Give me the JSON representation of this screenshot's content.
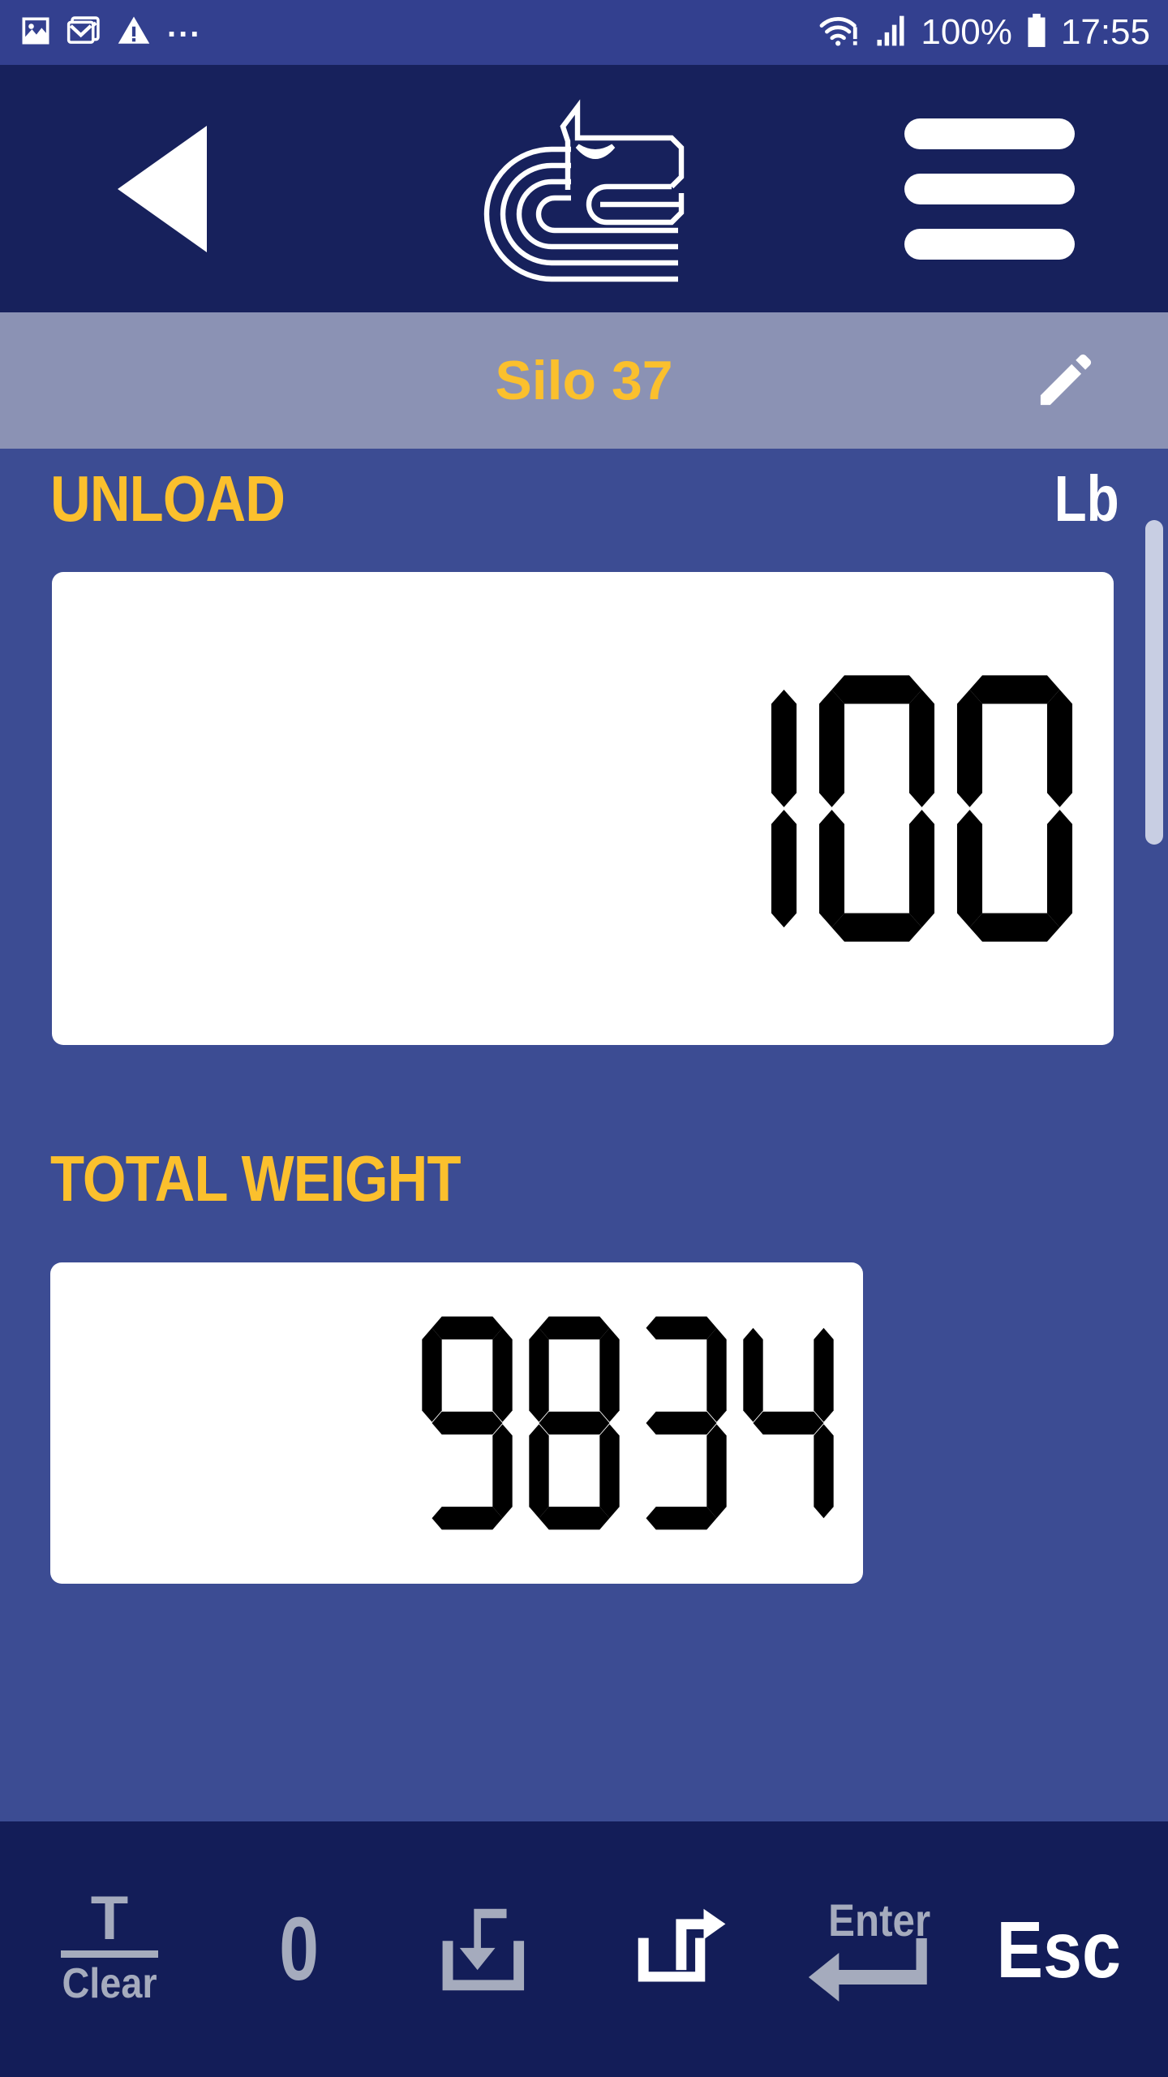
{
  "status_bar": {
    "left_icons": [
      "image-icon",
      "email-icon",
      "warning-icon"
    ],
    "overflow_dots": "...",
    "wifi_icon": "wifi-warning-icon",
    "signal_icon": "signal-bars-icon",
    "battery_percent": "100%",
    "battery_icon": "battery-full-icon",
    "time": "17:55"
  },
  "header": {
    "back_label": "back-arrow",
    "logo_label": "bull-head-logo",
    "menu_label": "menu"
  },
  "title_bar": {
    "title": "Silo 37",
    "edit_label": "edit"
  },
  "main": {
    "mode_label": "UNLOAD",
    "unit_label": "Lb",
    "primary_value": "100",
    "total_label": "TOTAL WEIGHT",
    "total_value": "9834"
  },
  "toolbar": {
    "tare_symbol": "T",
    "tare_label": "Clear",
    "zero_label": "0",
    "load_in_label": "load-in",
    "unload_out_label": "unload-out",
    "enter_label": "Enter",
    "esc_label": "Esc"
  },
  "colors": {
    "status_bar_bg": "#33408f",
    "header_bg": "#17215c",
    "title_bar_bg": "#8b92b4",
    "body_bg": "#3c4c93",
    "bottom_bar_bg": "#131d58",
    "accent_gold": "#fbc02d",
    "inactive_gray": "#a5abbd",
    "active_white": "#ffffff",
    "card_bg": "#ffffff",
    "segment_on": "#000000"
  }
}
